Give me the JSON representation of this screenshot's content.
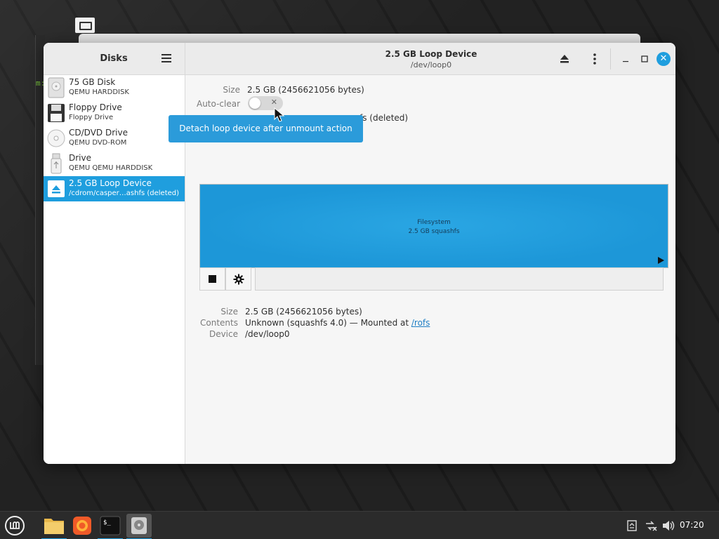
{
  "sidebar": {
    "title": "Disks",
    "items": [
      {
        "name": "75 GB Disk",
        "sub": "QEMU HARDDISK",
        "icon": "harddisk-icon"
      },
      {
        "name": "Floppy Drive",
        "sub": "Floppy Drive",
        "icon": "floppy-icon"
      },
      {
        "name": "CD/DVD Drive",
        "sub": "QEMU DVD-ROM",
        "icon": "cdrom-icon"
      },
      {
        "name": "Drive",
        "sub": "QEMU QEMU HARDDISK",
        "icon": "usb-drive-icon"
      },
      {
        "name": "2.5 GB Loop Device",
        "sub": "/cdrom/casper…ashfs (deleted)",
        "icon": "eject-icon",
        "selected": true
      }
    ]
  },
  "header": {
    "title": "2.5 GB Loop Device",
    "subtitle": "/dev/loop0"
  },
  "device": {
    "size_label": "Size",
    "size_value": "2.5 GB (2456621056 bytes)",
    "autoclear_label": "Auto-clear",
    "backing_partial": "fs (deleted)",
    "tooltip": "Detach loop device after unmount action"
  },
  "volume": {
    "partition_title": "Filesystem",
    "partition_sub": "2.5 GB squashfs"
  },
  "partition_info": {
    "size_label": "Size",
    "size_value": "2.5 GB (2456621056 bytes)",
    "contents_label": "Contents",
    "contents_prefix": "Unknown (squashfs 4.0) — Mounted at ",
    "contents_link": "/rofs",
    "device_label": "Device",
    "device_value": "/dev/loop0"
  },
  "background": {
    "terminal_snippet": "m:"
  },
  "taskbar": {
    "clock": "07:20",
    "apps": [
      "menu-icon",
      "files-icon",
      "firefox-icon",
      "terminal-icon",
      "disks-icon"
    ]
  },
  "colors": {
    "accent": "#1f9ede",
    "tooltip": "#2b9bda"
  }
}
